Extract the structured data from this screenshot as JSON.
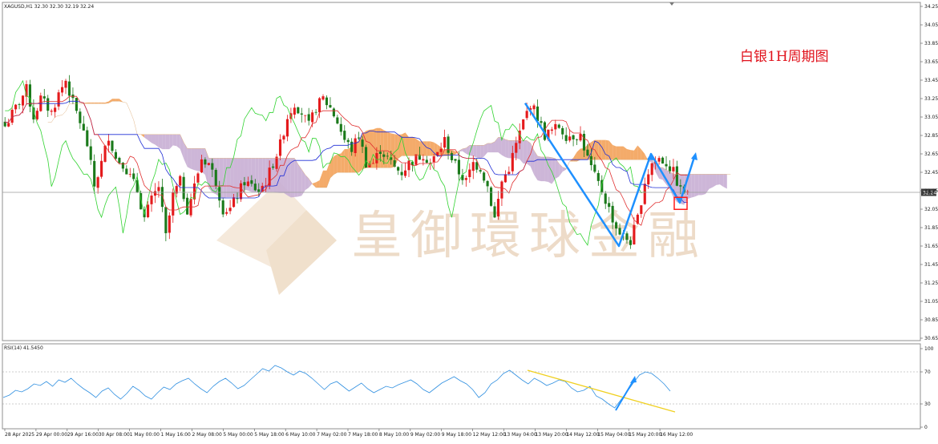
{
  "main_header": "XAGUSD,H1  32.30 32.30 32.19 32.24",
  "rsi_header": "RSI(14) 41.5450",
  "annotation": "白银1H周期图",
  "watermark": "皇御環球金融",
  "current_price_label": "32.24",
  "colors": {
    "bull_candle": "#e41a1c",
    "bear_candle": "#1b7a1b",
    "tenkan": "#e03030",
    "kijun": "#1f2dd6",
    "chikou": "#31d331",
    "cloud_bull": "#f3a25a",
    "cloud_bear": "#c8aed4",
    "rsi_line": "#2f8fe0",
    "trend_line": "#f0d020",
    "arrows": "#1e90ff",
    "highlight_box": "#ff1a1a"
  },
  "chart_data": [
    {
      "type": "candlestick",
      "title": "XAGUSD,H1",
      "ohlc_header": {
        "open": 32.3,
        "high": 32.3,
        "low": 32.19,
        "close": 32.24
      },
      "overlays": [
        "Ichimoku Tenkan-sen",
        "Ichimoku Kijun-sen",
        "Ichimoku Chikou span",
        "Ichimoku cloud"
      ],
      "ylim": [
        30.55,
        34.3
      ],
      "y_ticks": [
        "34.25",
        "34.05",
        "33.85",
        "33.65",
        "33.45",
        "33.25",
        "33.05",
        "32.85",
        "32.65",
        "32.45",
        "32.25",
        "32.05",
        "31.85",
        "31.65",
        "31.45",
        "31.25",
        "31.05",
        "30.85",
        "30.65"
      ],
      "current_price": 32.24,
      "x_tick_labels": [
        "28 Apr 2025",
        "29 Apr 00:00",
        "29 Apr 16:00",
        "30 Apr 08:00",
        "1 May 00:00",
        "1 May 16:00",
        "2 May 08:00",
        "5 May 00:00",
        "5 May 18:00",
        "6 May 10:00",
        "7 May 02:00",
        "7 May 18:00",
        "8 May 10:00",
        "9 May 02:00",
        "9 May 18:00",
        "12 May 12:00",
        "13 May 04:00",
        "13 May 20:00",
        "14 May 12:00",
        "15 May 04:00",
        "15 May 20:00",
        "16 May 12:00"
      ],
      "close_path": [
        [
          0,
          32.95
        ],
        [
          3,
          33.15
        ],
        [
          6,
          33.35
        ],
        [
          8,
          33.05
        ],
        [
          10,
          33.25
        ],
        [
          13,
          33.1
        ],
        [
          15,
          33.3
        ],
        [
          17,
          33.45
        ],
        [
          19,
          33.2
        ],
        [
          21,
          33.0
        ],
        [
          23,
          32.75
        ],
        [
          25,
          32.3
        ],
        [
          27,
          32.55
        ],
        [
          29,
          32.85
        ],
        [
          31,
          32.6
        ],
        [
          33,
          32.55
        ],
        [
          35,
          32.4
        ],
        [
          37,
          32.25
        ],
        [
          39,
          31.95
        ],
        [
          41,
          32.15
        ],
        [
          43,
          32.3
        ],
        [
          45,
          31.75
        ],
        [
          47,
          32.2
        ],
        [
          49,
          32.35
        ],
        [
          51,
          32.05
        ],
        [
          53,
          32.3
        ],
        [
          55,
          32.6
        ],
        [
          57,
          32.55
        ],
        [
          59,
          32.35
        ],
        [
          61,
          32.05
        ],
        [
          63,
          32.05
        ],
        [
          65,
          32.2
        ],
        [
          67,
          32.35
        ],
        [
          69,
          32.3
        ],
        [
          71,
          32.25
        ],
        [
          73,
          32.35
        ],
        [
          75,
          32.55
        ],
        [
          77,
          32.75
        ],
        [
          79,
          33.05
        ],
        [
          81,
          33.2
        ],
        [
          83,
          33.1
        ],
        [
          85,
          32.95
        ],
        [
          87,
          33.15
        ],
        [
          89,
          33.25
        ],
        [
          91,
          33.15
        ],
        [
          93,
          33.0
        ],
        [
          95,
          32.8
        ],
        [
          97,
          32.7
        ],
        [
          99,
          32.85
        ],
        [
          101,
          32.55
        ],
        [
          103,
          32.55
        ],
        [
          105,
          32.7
        ],
        [
          107,
          32.6
        ],
        [
          109,
          32.5
        ],
        [
          111,
          32.45
        ],
        [
          113,
          32.55
        ],
        [
          115,
          32.6
        ],
        [
          117,
          32.65
        ],
        [
          119,
          32.55
        ],
        [
          121,
          32.65
        ],
        [
          123,
          32.8
        ],
        [
          125,
          32.6
        ],
        [
          127,
          32.45
        ],
        [
          129,
          32.35
        ],
        [
          131,
          32.55
        ],
        [
          133,
          32.5
        ],
        [
          135,
          32.3
        ],
        [
          137,
          31.95
        ],
        [
          139,
          32.35
        ],
        [
          141,
          32.5
        ],
        [
          143,
          32.75
        ],
        [
          145,
          33.0
        ],
        [
          147,
          33.2
        ],
        [
          149,
          33.05
        ],
        [
          151,
          32.85
        ],
        [
          153,
          32.9
        ],
        [
          155,
          32.95
        ],
        [
          157,
          32.85
        ],
        [
          159,
          32.85
        ],
        [
          161,
          32.85
        ],
        [
          163,
          32.6
        ],
        [
          165,
          32.4
        ],
        [
          167,
          32.25
        ],
        [
          169,
          32.05
        ],
        [
          171,
          31.85
        ],
        [
          173,
          31.75
        ],
        [
          175,
          31.7
        ],
        [
          177,
          31.95
        ],
        [
          179,
          32.35
        ],
        [
          181,
          32.55
        ],
        [
          183,
          32.6
        ],
        [
          185,
          32.55
        ],
        [
          187,
          32.45
        ],
        [
          189,
          32.25
        ],
        [
          191,
          32.24
        ]
      ],
      "annotations": {
        "zigzag_prices": [
          33.2,
          31.65,
          32.65,
          32.12,
          32.65
        ],
        "highlight_price": 32.1,
        "text": "白银1H周期图"
      }
    },
    {
      "type": "line",
      "title": "RSI(14)",
      "last_value": 41.545,
      "ylim": [
        0,
        100
      ],
      "y_ticks": [
        "100",
        "70",
        "30",
        "0"
      ],
      "levels": [
        70,
        30
      ],
      "series": [
        {
          "values": [
            38,
            41,
            47,
            45,
            49,
            55,
            53,
            58,
            52,
            60,
            57,
            62,
            55,
            49,
            44,
            38,
            46,
            50,
            42,
            36,
            43,
            52,
            47,
            40,
            36,
            44,
            51,
            48,
            55,
            59,
            62,
            55,
            49,
            44,
            52,
            58,
            62,
            56,
            49,
            53,
            60,
            67,
            74,
            71,
            78,
            75,
            70,
            66,
            71,
            68,
            62,
            55,
            48,
            55,
            58,
            52,
            46,
            51,
            56,
            49,
            44,
            48,
            52,
            50,
            54,
            57,
            60,
            55,
            48,
            44,
            50,
            56,
            60,
            64,
            59,
            55,
            48,
            38,
            44,
            55,
            60,
            68,
            72,
            66,
            60,
            55,
            62,
            58,
            53,
            56,
            60,
            58,
            50,
            45,
            47,
            52,
            40,
            36,
            30,
            25,
            35,
            45,
            56,
            66,
            70,
            68,
            62,
            55,
            46
          ]
        },
        {
          "name": "",
          "values": []
        }
      ],
      "trend_line": {
        "from": 72,
        "to": 20
      },
      "arrow": {
        "from": 22,
        "to": 62
      }
    }
  ]
}
